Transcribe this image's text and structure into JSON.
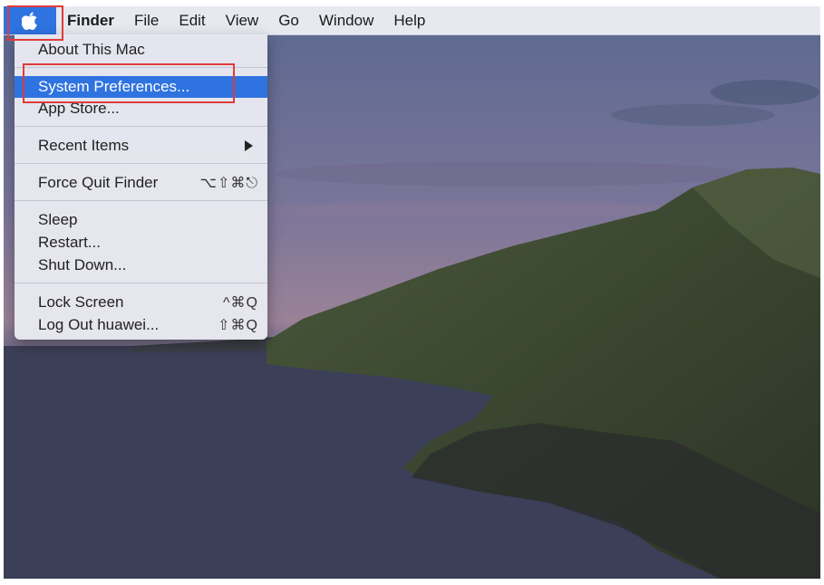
{
  "menubar": {
    "apple_icon": "apple-logo-icon",
    "items": [
      "Finder",
      "File",
      "Edit",
      "View",
      "Go",
      "Window",
      "Help"
    ]
  },
  "apple_menu": {
    "about": "About This Mac",
    "system_prefs": "System Preferences...",
    "app_store": "App Store...",
    "recent_items": "Recent Items",
    "force_quit": "Force Quit Finder",
    "force_quit_shortcut": "⌥⇧⌘⎋",
    "sleep": "Sleep",
    "restart": "Restart...",
    "shut_down": "Shut Down...",
    "lock_screen": "Lock Screen",
    "lock_screen_shortcut": "^⌘Q",
    "log_out": "Log Out huawei...",
    "log_out_shortcut": "⇧⌘Q"
  },
  "colors": {
    "selection": "#2f73e0",
    "highlight_box": "#e23b3b"
  }
}
